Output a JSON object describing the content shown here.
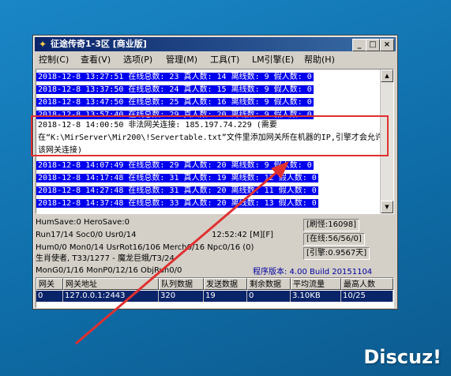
{
  "window": {
    "title": "征途传奇1-3区 [商业版]",
    "controls": {
      "minimize": "_",
      "maximize": "□",
      "close": "×"
    }
  },
  "menu": [
    {
      "label": "控制(C)"
    },
    {
      "label": "查看(V)"
    },
    {
      "label": "选项(P)"
    },
    {
      "label": "管理(M)"
    },
    {
      "label": "工具(T)"
    },
    {
      "label": "LM引擎(E)"
    },
    {
      "label": "帮助(H)"
    }
  ],
  "log": {
    "lines_before": [
      "2018-12-8 13:27:51 在线总数: 23 真人数: 14 离线数: 9 假人数: 0",
      "2018-12-8 13:37:50 在线总数: 24 真人数: 15 离线数: 9 假人数: 0",
      "2018-12-8 13:47:50 在线总数: 25 真人数: 16 离线数: 9 假人数: 0",
      "2018-12-8 13:57:40 在线总数: 29 真人数: 20 离线数: 9 假人数: 0"
    ],
    "warning": "2018-12-8 14:00:50 非法网关连接: 185.197.74.229 (需要在“K:\\MirServer\\Mir200\\!Servertable.txt”文件里添加网关所在机器的IP,引擎才会允许该网关连接)",
    "lines_after": [
      "2018-12-8 14:07:49 在线总数: 29 真人数: 20 离线数: 9 假人数: 0",
      "2018-12-8 14:17:48 在线总数: 31 真人数: 19 离线数: 12 假人数: 0",
      "2018-12-8 14:27:48 在线总数: 31 真人数: 20 离线数: 11 假人数: 0",
      "2018-12-8 14:37:48 在线总数: 33 真人数: 20 离线数: 13 假人数: 0"
    ]
  },
  "status": {
    "hum_save": "HumSave:0 HeroSave:0",
    "run": "Run17/14 Soc0/0 Usr0/14",
    "time": "12:52:42 [M][F]",
    "hum": "Hum0/0 Mon0/14 UsrRot16/106 Merch0/16 Npc0/16 (0)",
    "monster": "生肖使者, T33/1277 - 魔龙巨蛾/T3/24",
    "mon_gen": "MonG0/1/16 MonP0/12/16 ObjRun0/0",
    "refresh": "[刷怪:16098]",
    "online": "[在线:56/56/0]",
    "engine": "[引擎:0.9567天]",
    "version": "程序版本: 4.00 Build 20151104"
  },
  "grid": {
    "headers": [
      "网关",
      "网关地址",
      "队列数据",
      "发送数据",
      "剩余数据",
      "平均流量",
      "最高人数"
    ],
    "rows": [
      [
        "0",
        "127.0.0.1:2443",
        "320",
        "19",
        "0",
        "3.10KB",
        "10/25"
      ]
    ]
  },
  "watermark": "Discuz!",
  "colors": {
    "highlight": "#0000ee",
    "annotation": "#e03030",
    "titlebar": "#0a246a"
  }
}
